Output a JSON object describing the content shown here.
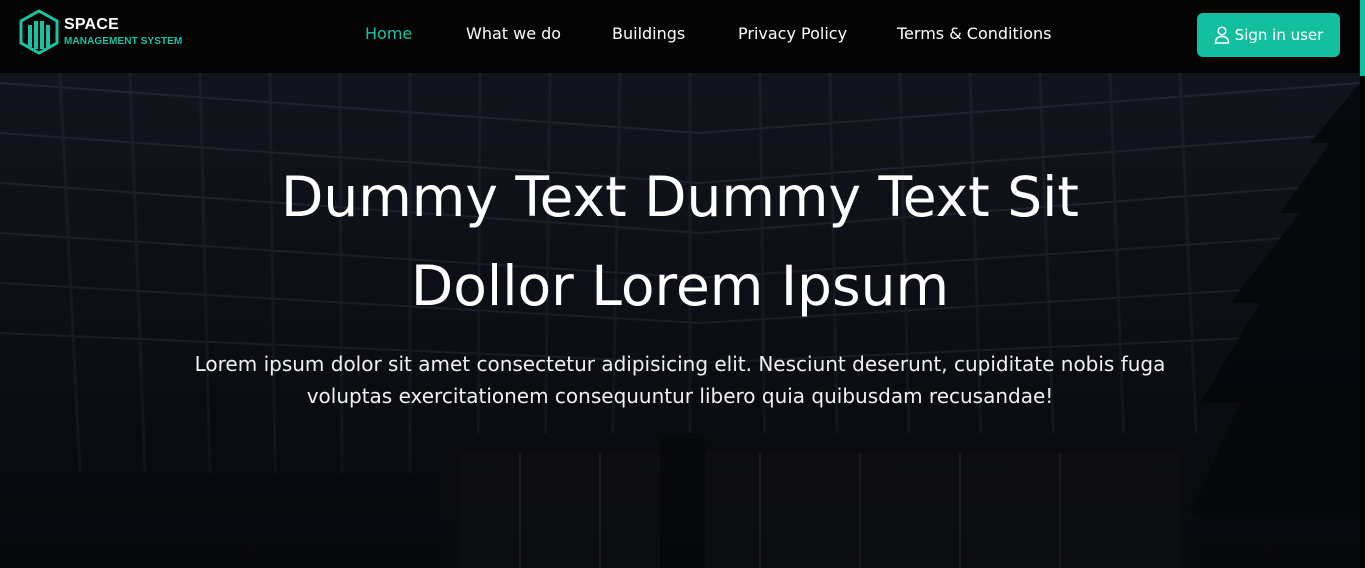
{
  "brand": {
    "title": "SPACE",
    "subtitle": "MANAGEMENT SYSTEM",
    "accent_color": "#18c3a2",
    "logo_icon": "building-logo-icon"
  },
  "nav": {
    "items": [
      {
        "label": "Home",
        "active": true
      },
      {
        "label": "What we do",
        "active": false
      },
      {
        "label": "Buildings",
        "active": false
      },
      {
        "label": "Privacy Policy",
        "active": false
      },
      {
        "label": "Terms & Conditions",
        "active": false
      }
    ],
    "signin": {
      "label": "Sign in user",
      "icon": "user-icon",
      "color": "#14bfa0"
    }
  },
  "hero": {
    "title_line1": "Dummy Text Dummy Text Sit",
    "title_line2": "Dollor Lorem Ipsum",
    "description_line1": "Lorem ipsum dolor sit amet consectetur adipisicing elit. Nesciunt deserunt, cupiditate nobis fuga",
    "description_line2": "voluptas exercitationem consequuntur libero quia quibusdam recusandae!",
    "background": "office-building-photo"
  }
}
